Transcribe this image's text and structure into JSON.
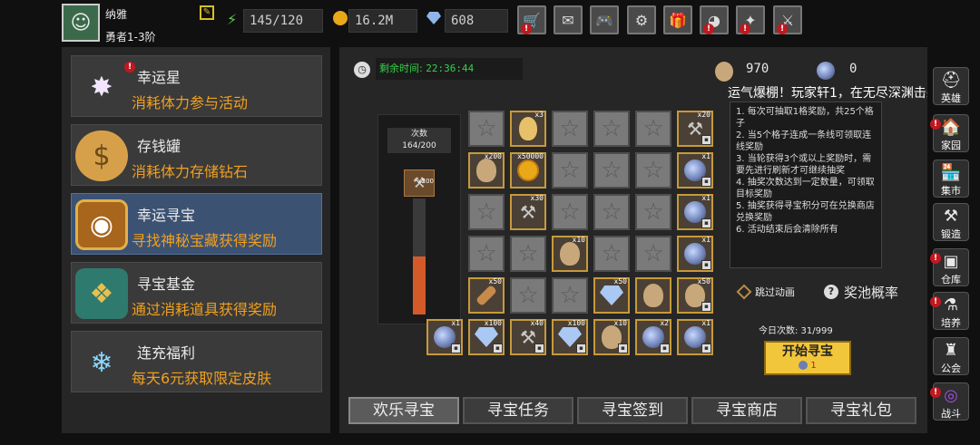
{
  "player": {
    "name": "纳雅",
    "rank": "勇者1-3阶"
  },
  "stats": {
    "stamina": "145/120",
    "gold": "16.2M",
    "gems": "608"
  },
  "top_icons": [
    "cart-icon",
    "mail-icon",
    "gamepad-icon",
    "gear-icon",
    "gift-icon",
    "wheel-icon",
    "sparkle-icon",
    "swords-icon"
  ],
  "sidebar": {
    "items": [
      {
        "title": "幸运星",
        "desc": "消耗体力参与活动",
        "icon": "star-icon"
      },
      {
        "title": "存钱罐",
        "desc": "消耗体力存储钻石",
        "icon": "piggy-bank-icon"
      },
      {
        "title": "幸运寻宝",
        "desc": "寻找神秘宝藏获得奖励",
        "icon": "treasure-icon"
      },
      {
        "title": "寻宝基金",
        "desc": "通过消耗道具获得奖励",
        "icon": "money-bag-icon"
      },
      {
        "title": "连充福利",
        "desc": "每天6元获取限定皮肤",
        "icon": "crystal-icon"
      }
    ]
  },
  "main": {
    "timer_label": "剩余时间:",
    "timer_value": "22:36:44",
    "currency1": "970",
    "currency2": "0",
    "ticker": "运气爆棚！玩家轩1，在无尽深渊击杀怪",
    "count_label": "次数",
    "count_value": "164/200",
    "progress_fraction": 0.5,
    "progress_item_count": "x200",
    "rules": [
      "1. 每次可抽取1格奖励，共25个格子",
      "2. 当5个格子连成一条线可领取连线奖励",
      "3. 当轮获得3个或以上奖励时，需要先进行刷新才可继续抽奖",
      "4. 抽奖次数达到一定数量，可领取目标奖励",
      "5. 抽奖获得寻宝积分可在兑换商店兑换奖励",
      "6. 活动结束后会清除所有"
    ],
    "skip_label": "跳过动画",
    "odds_label": "奖池概率",
    "today_label": "今日次数: 31/999",
    "start_label": "开始寻宝",
    "start_cost": "1",
    "grid_counts": {
      "r0c1": "x3",
      "r1c0": "x200",
      "r1c1": "x50000",
      "r2c1": "x30",
      "r3c2": "x10",
      "r4c0": "x50",
      "r4c3": "x50",
      "col5_0": "x20",
      "col5_1": "x1",
      "col5_2": "x1",
      "col5_3": "x1",
      "col5_4": "x50",
      "row5_0": "x1",
      "row5_1": "x100",
      "row5_2": "x40",
      "row5_3": "x100",
      "row5_4": "x10",
      "row5_5": "x2",
      "row5_6": "x1"
    }
  },
  "tabs": [
    "欢乐寻宝",
    "寻宝任务",
    "寻宝签到",
    "寻宝商店",
    "寻宝礼包"
  ],
  "right_nav": [
    "英雄",
    "家园",
    "集市",
    "锻造",
    "仓库",
    "培养",
    "公会",
    "战斗"
  ]
}
